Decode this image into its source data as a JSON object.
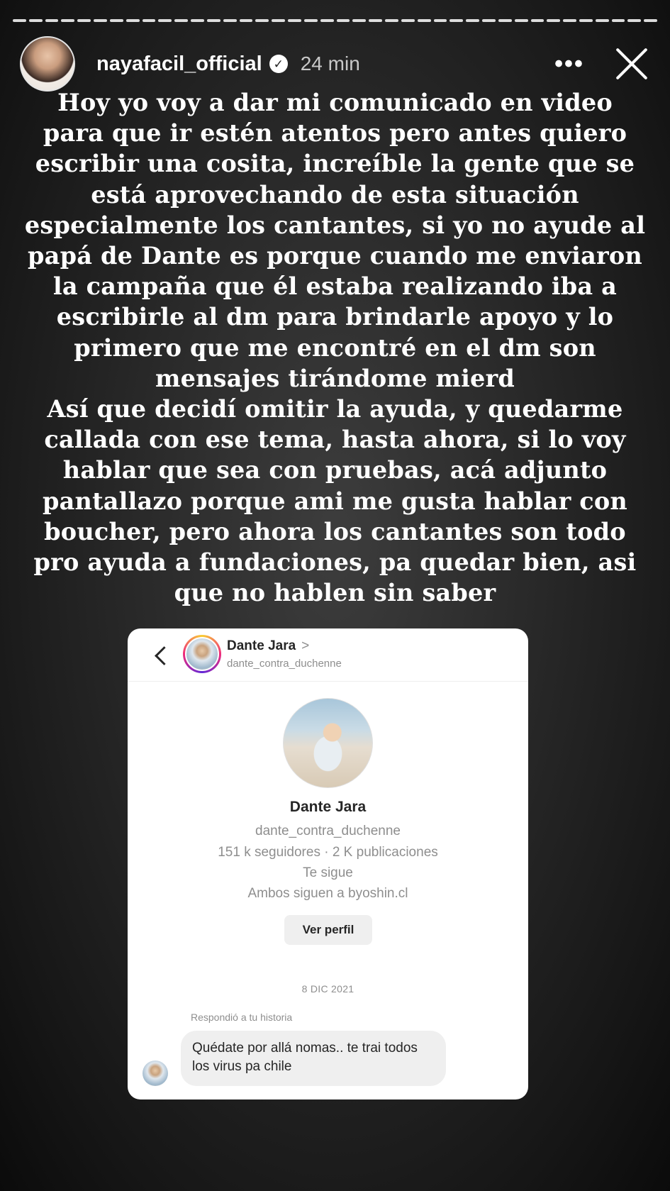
{
  "story": {
    "progress_segments": 40,
    "username": "nayafacil_official",
    "verified_icon": "check-badge",
    "time_ago": "24 min",
    "more_label": "•••",
    "caption": "Hoy yo voy a dar mi comunicado en video\npara que ir estén atentos pero antes quiero\nescribir una cosita, increíble la gente que se\nestá aprovechando de esta situación\nespecialmente los cantantes, si yo no ayude al\npapá de Dante es porque cuando me enviaron\nla campaña que él estaba realizando iba a\nescribirle al dm para brindarle apoyo y lo\nprimero que me encontré en el dm son\nmensajes tirándome mierd\nAsí que decidí omitir la ayuda, y quedarme\ncallada con ese tema, hasta ahora, si lo voy\nhablar que sea con pruebas, acá adjunto\npantallazo porque ami me gusta hablar con\nboucher, pero ahora los cantantes son todo\npro ayuda a fundaciones, pa quedar bien, asi\nque no hablen sin saber"
  },
  "screenshot": {
    "chat_name": "Dante Jara",
    "chat_chevron": ">",
    "chat_handle": "dante_contra_duchenne",
    "profile_name": "Dante Jara",
    "profile_handle": "dante_contra_duchenne",
    "profile_stats": "151 k seguidores · 2 K publicaciones",
    "follows_you": "Te sigue",
    "mutual": "Ambos siguen a byoshin.cl",
    "view_profile_label": "Ver perfil",
    "date": "8 DIC 2021",
    "reply_note": "Respondió a tu historia",
    "message": "Quédate por allá nomas.. te trai todos los virus pa chile"
  }
}
